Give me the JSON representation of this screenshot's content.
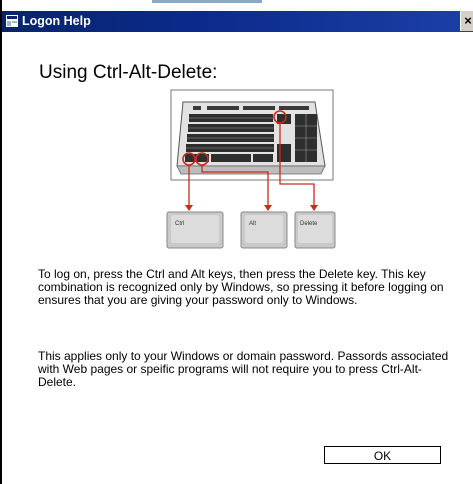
{
  "window": {
    "title": "Logon Help",
    "close_glyph": "×"
  },
  "content": {
    "heading": "Using Ctrl-Alt-Delete:",
    "keys": [
      "Ctrl",
      "Alt",
      "Delete"
    ],
    "paragraph1": "To log on, press the Ctrl and Alt keys, then press the Delete key. This key combination is recognized only by Windows, so pressing it before logging on ensures that you are giving your password only to Windows.",
    "paragraph2": "This applies only to your Windows or domain password. Passords associated with Web pages or speific programs will not require you to press Ctrl-Alt-Delete."
  },
  "buttons": {
    "ok_label": "OK"
  },
  "colors": {
    "titlebar": "#0a246a",
    "arrow": "#cc2a1a"
  }
}
